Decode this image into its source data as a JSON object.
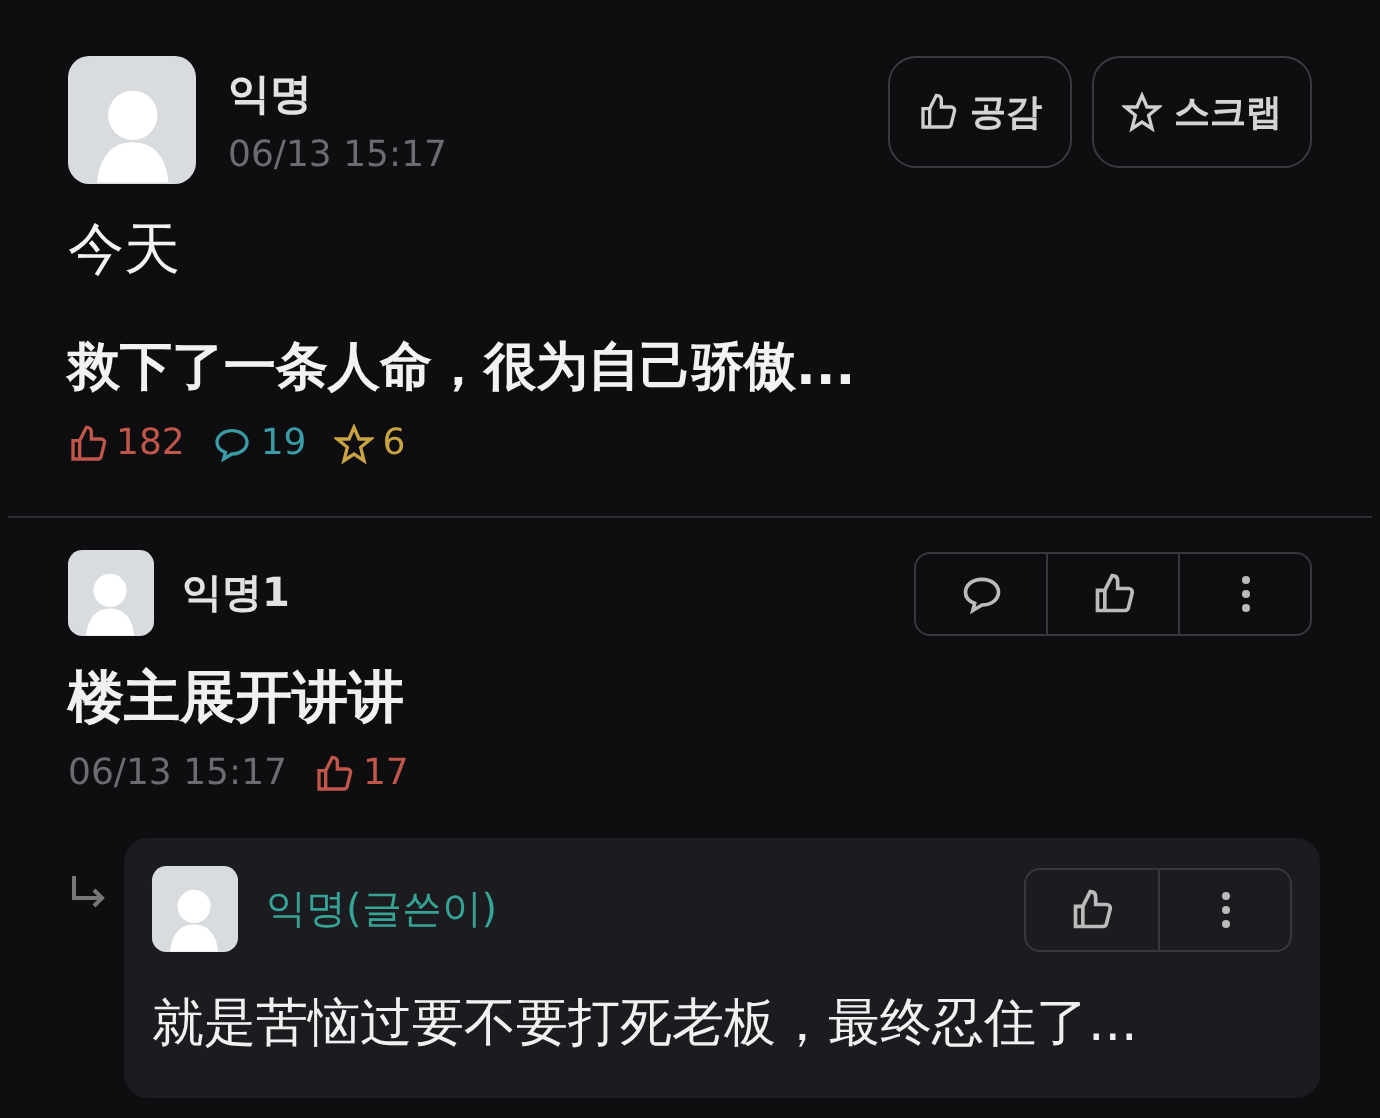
{
  "post": {
    "author": "익명",
    "time": "06/13 15:17",
    "buttons": [
      {
        "kind": "like",
        "label": "공감"
      },
      {
        "kind": "scrap",
        "label": "스크랩"
      }
    ],
    "title": "今天",
    "body": "救下了一条人命，很为自己骄傲...",
    "stats": [
      {
        "kind": "like",
        "count": "182",
        "color": "#c0574a"
      },
      {
        "kind": "comment",
        "count": "19",
        "color": "#3a9ca6"
      },
      {
        "kind": "star",
        "count": "6",
        "color": "#c9a443"
      }
    ]
  },
  "comments": [
    {
      "author": "익명1",
      "is_op": false,
      "text": "楼主展开讲讲",
      "time": "06/13 15:17",
      "likes": "17",
      "actions": [
        {
          "kind": "comment"
        },
        {
          "kind": "like"
        },
        {
          "kind": "more"
        }
      ],
      "replies": [
        {
          "author": "익명(글쓴이)",
          "is_op": true,
          "text": "就是苦恼过要不要打死老板，最终忍住了...",
          "actions": [
            {
              "kind": "like"
            },
            {
              "kind": "more"
            }
          ]
        }
      ]
    }
  ]
}
